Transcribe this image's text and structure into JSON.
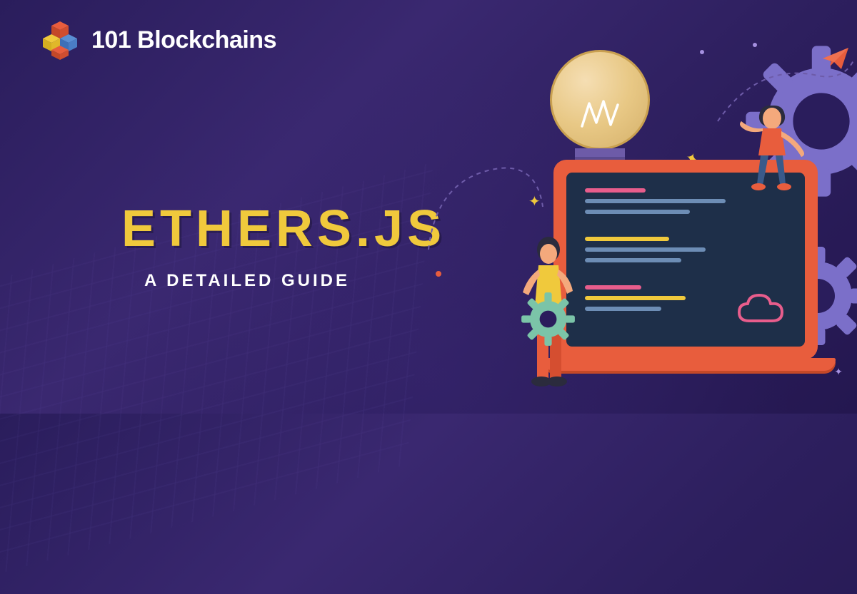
{
  "logo": {
    "text": "101 Blockchains",
    "name": "101-blockchains-logo"
  },
  "hero": {
    "title": "ETHERS.JS",
    "subtitle": "A DETAILED GUIDE"
  },
  "colors": {
    "background": "#2a1d5c",
    "title": "#f0c93c",
    "accent_orange": "#e85d3d",
    "accent_teal": "#7bc4a8",
    "gear_purple": "#7b6fc9",
    "text_white": "#ffffff"
  },
  "illustration": {
    "elements": [
      "lightbulb",
      "laptop-with-code",
      "person-sitting-top",
      "person-standing-holding-gear",
      "large-gear",
      "small-gear",
      "cloud-icon",
      "paper-plane",
      "decorative-stars",
      "dashed-paths"
    ]
  }
}
